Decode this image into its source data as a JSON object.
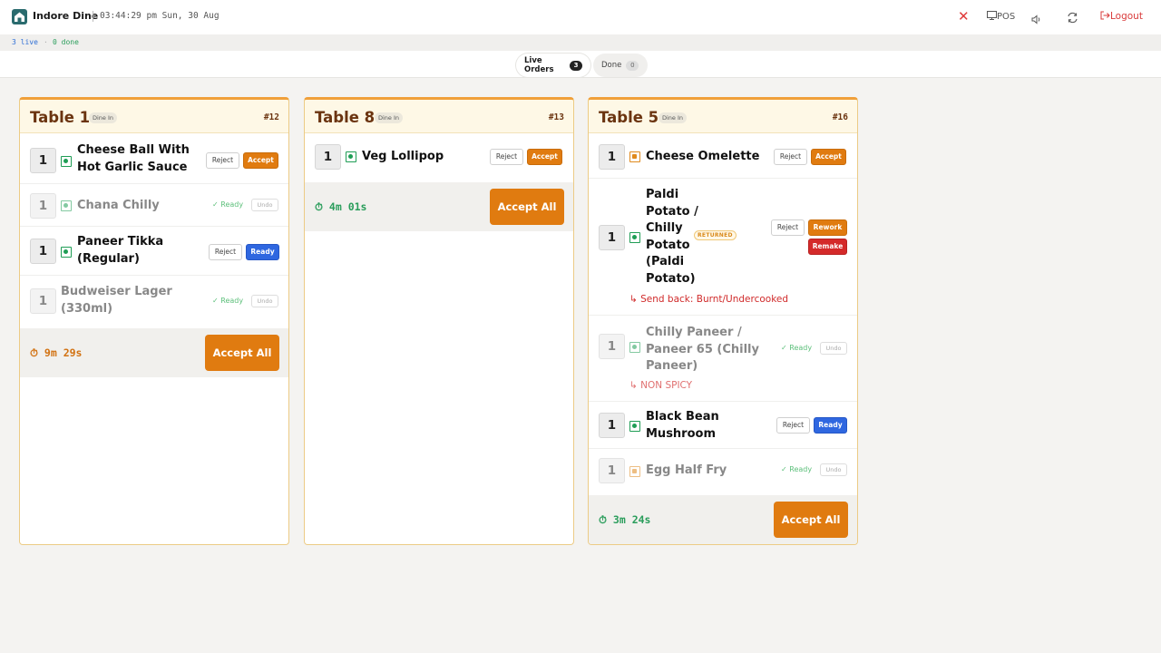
{
  "header": {
    "brand": "Indore Dine",
    "clock": "03:44:29 pm Sun, 30 Aug",
    "pos_label": "POS",
    "logout_label": "Logout"
  },
  "status": {
    "live": "3 live",
    "dot": "·",
    "done": "0 done"
  },
  "tabs": [
    {
      "label": "Live Orders",
      "count": "3"
    },
    {
      "label": "Done",
      "count": "0"
    }
  ],
  "labels": {
    "reject": "Reject",
    "accept": "Accept",
    "ready": "Ready",
    "undo": "Undo",
    "ready_tag": "✓ Ready",
    "rework": "Rework",
    "remake": "Remake",
    "accept_all": "Accept All",
    "returned": "RETURNED",
    "dine_in": "Dine In"
  },
  "orders": [
    {
      "table": "Table 1",
      "order_no": "#12",
      "timer": "9m 29s",
      "items": [
        {
          "qty": "1",
          "name": "Cheese Ball With Hot Garlic Sauce"
        },
        {
          "qty": "1",
          "name": "Chana Chilly"
        },
        {
          "qty": "1",
          "name": "Paneer Tikka (Regular)"
        },
        {
          "qty": "1",
          "name": "Budweiser Lager (330ml)"
        }
      ]
    },
    {
      "table": "Table 8",
      "order_no": "#13",
      "timer": "4m 01s",
      "items": [
        {
          "qty": "1",
          "name": "Veg Lollipop"
        }
      ]
    },
    {
      "table": "Table 5",
      "order_no": "#16",
      "timer": "3m 24s",
      "items": [
        {
          "qty": "1",
          "name": "Cheese Omelette"
        },
        {
          "qty": "1",
          "name": "Paldi Potato / Chilly Potato (Paldi Potato)",
          "note": "↳ Send back: Burnt/Undercooked"
        },
        {
          "qty": "1",
          "name": "Chilly Paneer / Paneer 65 (Chilly Paneer)",
          "note": "↳ NON SPICY"
        },
        {
          "qty": "1",
          "name": "Black Bean Mushroom"
        },
        {
          "qty": "1",
          "name": "Egg Half Fry"
        }
      ]
    }
  ],
  "colors": {
    "accent": "#e07b10",
    "ready_blue": "#2f67e0",
    "remake_red": "#d42a2a",
    "veg_green": "#1f9d55",
    "nonveg_orange": "#e08a1e",
    "card_border": "#f0a03a"
  }
}
